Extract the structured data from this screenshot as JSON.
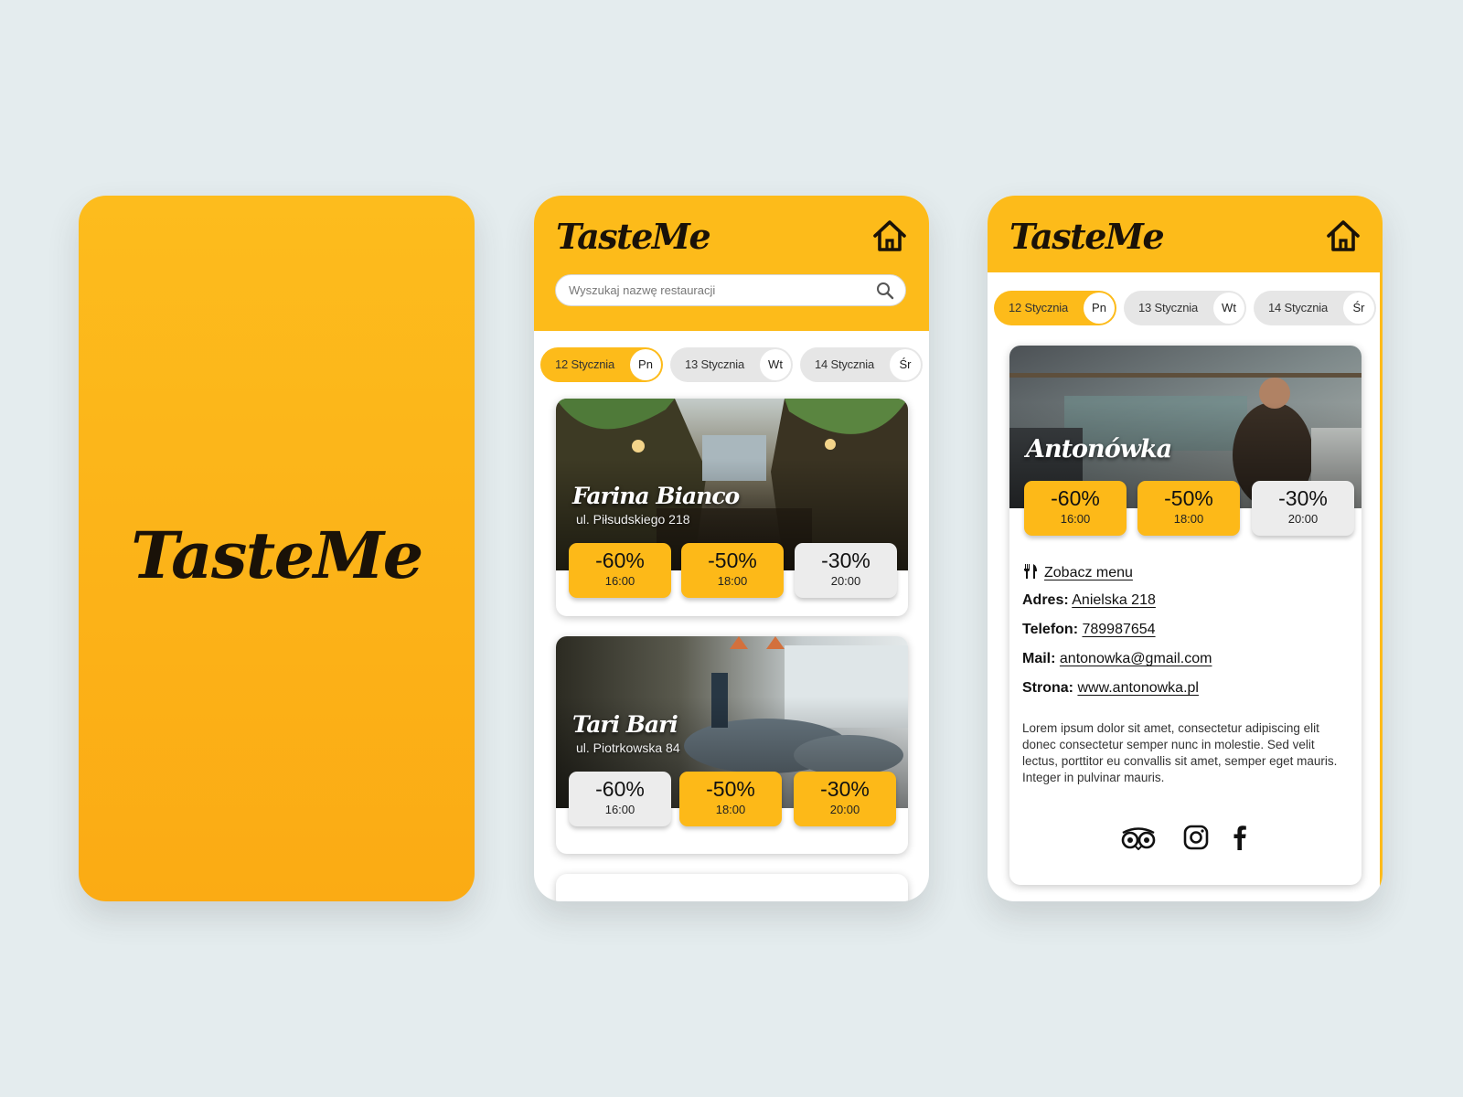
{
  "app": {
    "name": "TasteMe"
  },
  "colors": {
    "accent": "#fdbb1a",
    "deal_inactive": "#ececec",
    "background": "#e4ecee"
  },
  "icons": {
    "home": "home-icon",
    "search": "search-icon",
    "menu": "fork-knife-icon",
    "tripadvisor": "tripadvisor-icon",
    "instagram": "instagram-icon",
    "facebook": "facebook-icon"
  },
  "search": {
    "placeholder": "Wyszukaj nazwę restauracji"
  },
  "tabs": [
    {
      "date": "12 Stycznia",
      "day": "Pn",
      "active": true
    },
    {
      "date": "13 Stycznia",
      "day": "Wt",
      "active": false
    },
    {
      "date": "14 Stycznia",
      "day": "Śr",
      "active": false
    }
  ],
  "restaurants": [
    {
      "name": "Farina Bianco",
      "address": "ul. Piłsudskiego 218",
      "deals": [
        {
          "pct": "-60%",
          "time": "16:00",
          "available": true
        },
        {
          "pct": "-50%",
          "time": "18:00",
          "available": true
        },
        {
          "pct": "-30%",
          "time": "20:00",
          "available": false
        }
      ]
    },
    {
      "name": "Tari Bari",
      "address": "ul. Piotrkowska 84",
      "deals": [
        {
          "pct": "-60%",
          "time": "16:00",
          "available": false
        },
        {
          "pct": "-50%",
          "time": "18:00",
          "available": true
        },
        {
          "pct": "-30%",
          "time": "20:00",
          "available": true
        }
      ]
    }
  ],
  "detail": {
    "name": "Antonówka",
    "deals": [
      {
        "pct": "-60%",
        "time": "16:00",
        "available": true
      },
      {
        "pct": "-50%",
        "time": "18:00",
        "available": true
      },
      {
        "pct": "-30%",
        "time": "20:00",
        "available": false
      }
    ],
    "menu_link": "Zobacz menu",
    "address_label": "Adres:",
    "address": "Anielska 218",
    "phone_label": "Telefon:",
    "phone": "789987654",
    "mail_label": "Mail:",
    "mail": "antonowka@gmail.com",
    "web_label": "Strona:",
    "web": "www.antonowka.pl",
    "description": "Lorem ipsum dolor sit amet, consectetur adipiscing elit donec consectetur semper nunc in molestie. Sed velit lectus, porttitor eu convallis sit amet, semper eget mauris. Integer in pulvinar mauris."
  }
}
